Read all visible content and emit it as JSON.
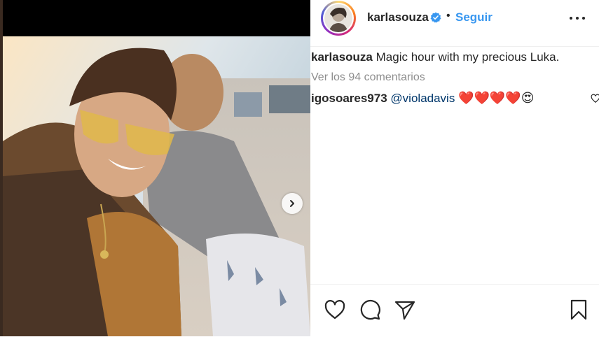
{
  "post": {
    "author": "karlasouza",
    "follow_label": "Seguir",
    "separator": "•",
    "caption": "Magic hour with my precious Luka.",
    "view_comments": "Ver los 94 comentarios",
    "comments": [
      {
        "user": "igosoares973",
        "mention": "@violadavis",
        "emojis": "❤️❤️❤️❤️😍"
      }
    ]
  },
  "icons": {
    "verified": "verified-badge-icon",
    "more": "more-options-icon",
    "next": "chevron-right-icon",
    "like": "heart-icon",
    "comment": "comment-bubble-icon",
    "share": "paper-plane-icon",
    "save": "bookmark-icon"
  },
  "colors": {
    "link_blue": "#3897f0",
    "text": "#262626",
    "muted": "#8e8e8e",
    "mention": "#00376b",
    "heart_red": "#ed4956"
  }
}
